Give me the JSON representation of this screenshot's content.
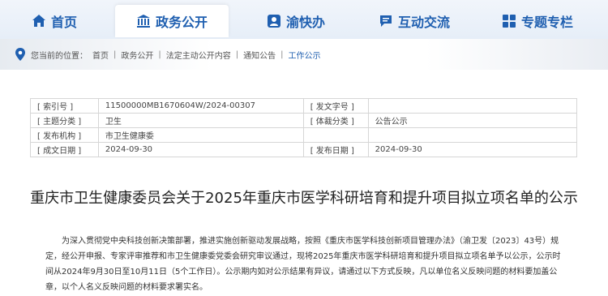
{
  "nav": {
    "items": [
      {
        "label": "首页",
        "icon": "home-icon"
      },
      {
        "label": "政务公开",
        "icon": "building-icon"
      },
      {
        "label": "渝快办",
        "icon": "person-icon"
      },
      {
        "label": "互动交流",
        "icon": "chat-icon"
      },
      {
        "label": "专题专栏",
        "icon": "grid-icon"
      }
    ]
  },
  "breadcrumb": {
    "prefix": "您当前的位置：",
    "items": [
      "首页",
      "政务公开",
      "法定主动公开内容",
      "通知公告",
      "工作公示"
    ]
  },
  "meta": {
    "rows": [
      {
        "l1": "[ 索引号 ]",
        "v1": "11500000MB1670604W/2024-00307",
        "l2": "[ 发文字号 ]",
        "v2": ""
      },
      {
        "l1": "[ 主题分类 ]",
        "v1": "卫生",
        "l2": "[ 体裁分类 ]",
        "v2": "公告公示"
      },
      {
        "l1": "[ 发布机构 ]",
        "v1": "市卫生健康委",
        "l2": "",
        "v2": ""
      },
      {
        "l1": "[ 成文日期 ]",
        "v1": "2024-09-30",
        "l2": "[ 发布日期 ]",
        "v2": "2024-09-30"
      }
    ]
  },
  "article": {
    "title": "重庆市卫生健康委员会关于2025年重庆市医学科研培育和提升项目拟立项名单的公示",
    "body": "为深入贯彻党中央科技创新决策部署，推进实施创新驱动发展战略，按照《重庆市医学科技创新项目管理办法》（渝卫发〔2023〕43号）规定，经公开申报、专家评审推荐和市卫生健康委党委会研究审议通过，现将2025年重庆市医学科研培育和提升项目拟立项名单予以公示，公示时间从2024年9月30日至10月11日（5个工作日）。公示期内如对公示结果有异议，请通过以下方式反映，凡以单位名义反映问题的材料要加盖公章，以个人名义反映问题的材料要求署实名。"
  }
}
